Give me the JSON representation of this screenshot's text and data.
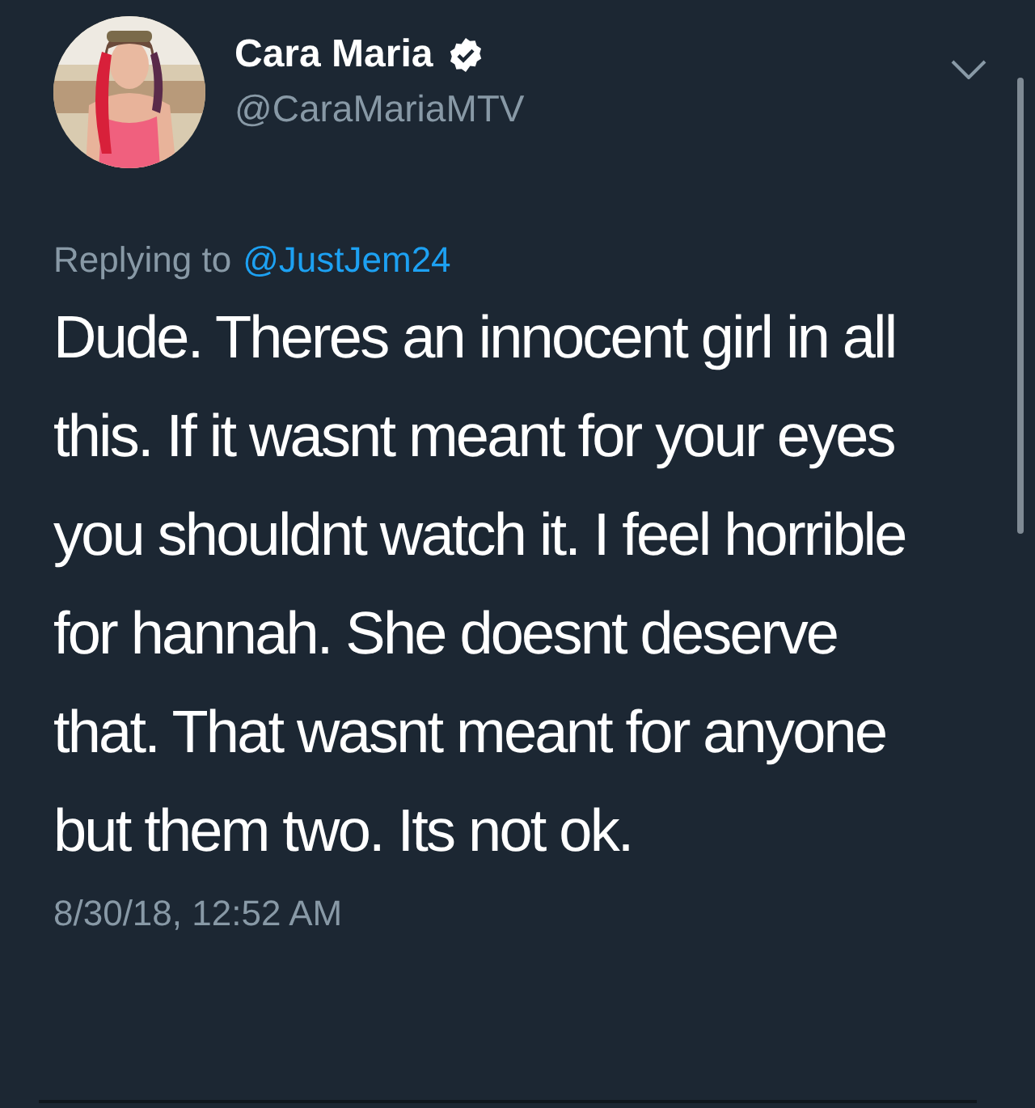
{
  "author": {
    "name": "Cara Maria",
    "verified": true,
    "handle": "@CaraMariaMTV"
  },
  "reply_to": {
    "prefix": "Replying to",
    "handle": "@JustJem24"
  },
  "text": "Dude. Theres an innocent girl in all this. If it wasnt meant for your eyes you shouldnt watch it. I feel horrible for hannah. She doesnt deserve that.  That wasnt meant for anyone but them two. Its not ok.",
  "timestamp": "8/30/18, 12:52 AM"
}
